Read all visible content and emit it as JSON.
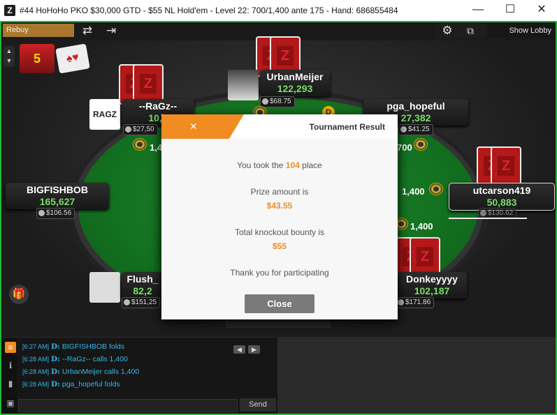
{
  "window": {
    "title": "#44 HoHoHo PKO $30,000 GTD - $55 NL Hold'em - Level 22: 700/1,400 ante 175 - Hand: 686855484",
    "app_icon": "Z",
    "minimize": "—",
    "maximize": "☐",
    "close": "✕"
  },
  "toolbar": {
    "rebuy_label": "Rebuy",
    "show_lobby_label": "Show Lobby",
    "accent_color": "#1dbb38",
    "rebuy_color": "#a9772d"
  },
  "players": [
    {
      "name": "UrbanMeijer",
      "chips": "122,293",
      "bounty": "$68.75"
    },
    {
      "name": "--RaGz--",
      "chips": "10,6",
      "bounty": "$27,50",
      "avatar_text": "RAGZ"
    },
    {
      "name": "pga_hopeful",
      "chips": "27,382",
      "bounty": "$41.25"
    },
    {
      "name": "BIGFISHBOB",
      "chips": "165,627",
      "bounty": "$106.56"
    },
    {
      "name": "utcarson419",
      "chips": "50,883",
      "bounty": "$130.62"
    },
    {
      "name": "Flush_",
      "chips": "82,2",
      "bounty": "$151,25"
    },
    {
      "name": "Donkeyyyy",
      "chips": "102,187",
      "bounty": "$171.86"
    }
  ],
  "table": {
    "bets": [
      "1,4",
      "700",
      "1,400",
      "1,400"
    ],
    "dealer_button": "D"
  },
  "chat": {
    "lines": [
      {
        "time": "[6:27 AM]",
        "tag": "D:",
        "text": "BIGFISHBOB  folds"
      },
      {
        "time": "[6:28 AM]",
        "tag": "D:",
        "text": "--RaGz--  calls 1,400"
      },
      {
        "time": "[6:28 AM]",
        "tag": "D:",
        "text": "UrbanMeijer  calls 1,400"
      },
      {
        "time": "[6:28 AM]",
        "tag": "D:",
        "text": "pga_hopeful  folds"
      }
    ],
    "send_label": "Send"
  },
  "modal": {
    "close_icon": "✕",
    "title": "Tournament Result",
    "place_prefix": "You took the",
    "place_value": "104",
    "place_suffix": "place",
    "prize_label": "Prize amount is",
    "prize_value": "$43.55",
    "bounty_label": "Total knockout bounty is",
    "bounty_value": "$55",
    "thanks": "Thank you for participating",
    "close_button": "Close",
    "accent_color": "#f08c22"
  }
}
